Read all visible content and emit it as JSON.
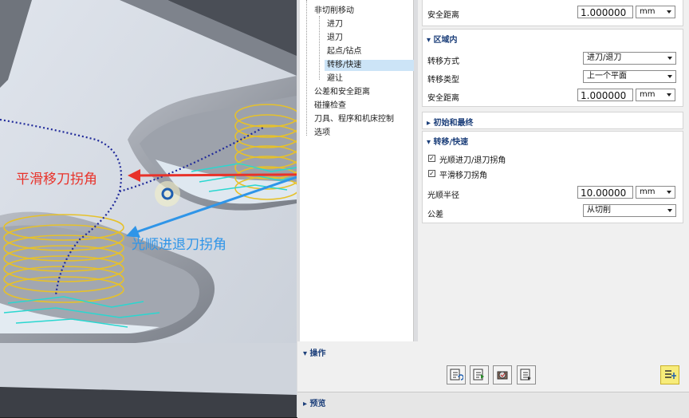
{
  "annotations": {
    "smooth_transfer_corner": "平滑移刀拐角",
    "smooth_engage_retract_corner": "光顺进退刀拐角"
  },
  "tree": {
    "items": [
      {
        "label": "非切削移动"
      },
      {
        "label": "进刀"
      },
      {
        "label": "退刀"
      },
      {
        "label": "起点/钻点"
      },
      {
        "label": "转移/快速",
        "selected": true
      },
      {
        "label": "避让"
      },
      {
        "label": "公差和安全距离"
      },
      {
        "label": "碰撞检查"
      },
      {
        "label": "刀具、程序和机床控制"
      },
      {
        "label": "选项"
      }
    ]
  },
  "top_section": {
    "safe_distance_label": "安全距离",
    "safe_distance_value": "1.000000",
    "safe_distance_unit": "mm"
  },
  "within_region": {
    "title": "区域内",
    "transfer_method_label": "转移方式",
    "transfer_method_value": "进刀/退刀",
    "transfer_type_label": "转移类型",
    "transfer_type_value": "上一个平面",
    "safe_distance_label": "安全距离",
    "safe_distance_value": "1.000000",
    "safe_distance_unit": "mm"
  },
  "initial_final": {
    "title": "初始和最终"
  },
  "transfer_rapid": {
    "title": "转移/快速",
    "smooth_engage_retract_label": "光顺进刀/退刀拐角",
    "smooth_engage_retract_checked": true,
    "smooth_transfer_label": "平滑移刀拐角",
    "smooth_transfer_checked": true,
    "smooth_radius_label": "光顺半径",
    "smooth_radius_value": "10.00000",
    "smooth_radius_unit": "mm",
    "tolerance_label": "公差",
    "tolerance_value": "从切削"
  },
  "operations": {
    "title": "操作"
  },
  "preview": {
    "title": "预览"
  },
  "colors": {
    "red_arrow": "#e8322a",
    "blue_arrow": "#2f95e8",
    "toolpath_yellow": "#e6c12a",
    "toolpath_cyan": "#2ad7d0",
    "rapid_path_blue": "#202a9a",
    "tree_selection": "#cce4f7",
    "group_title": "#1c3f7a"
  }
}
